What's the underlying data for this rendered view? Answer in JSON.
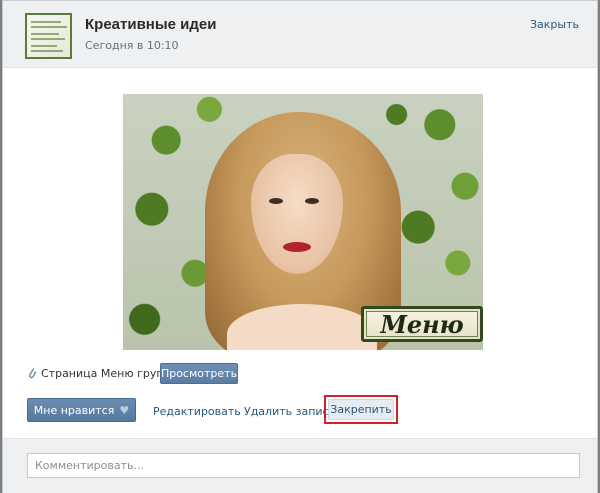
{
  "post": {
    "group_name": "Креативные идеи",
    "time": "Сегодня в 10:10",
    "close_label": "Закрыть"
  },
  "image": {
    "badge_text": "Меню"
  },
  "attachment": {
    "page_text": "Страница Меню группы",
    "view_label": "Просмотреть"
  },
  "actions": {
    "like_label": "Мне нравится",
    "edit_label": "Редактировать",
    "delete_label": "Удалить запись",
    "pin_label": "Закрепить"
  },
  "comment": {
    "placeholder": "Комментировать..."
  },
  "colors": {
    "link": "#2b587a",
    "button_blue": "#5a7ea4",
    "highlight_red": "#d4202a"
  }
}
